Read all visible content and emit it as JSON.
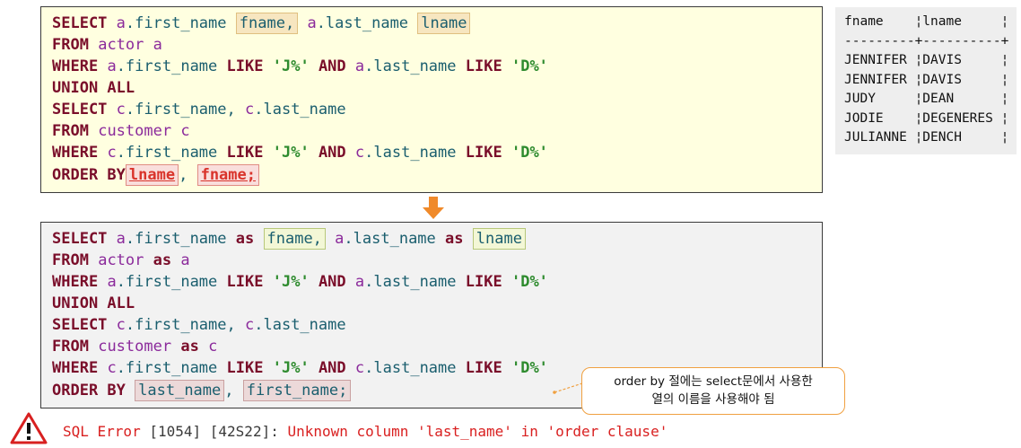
{
  "query1": {
    "l1": {
      "select": "SELECT",
      "a1": "a",
      "f1": ".first_name",
      "alias1": "fname,",
      "a2": "a",
      "f2": ".last_name",
      "alias2": "lname"
    },
    "l2": {
      "from": "FROM",
      "tbl": "actor a"
    },
    "l3": {
      "where": "WHERE",
      "a1": "a",
      "f1": ".first_name",
      "like1": "LIKE",
      "s1": "'J%'",
      "and": "AND",
      "a2": "a",
      "f2": ".last_name",
      "like2": "LIKE",
      "s2": "'D%'"
    },
    "l4": {
      "union": "UNION ALL"
    },
    "l5": {
      "select": "SELECT",
      "c1": "c",
      "f1": ".first_name,",
      "c2": "c",
      "f2": ".last_name"
    },
    "l6": {
      "from": "FROM",
      "tbl": "customer c"
    },
    "l7": {
      "where": "WHERE",
      "c1": "c",
      "f1": ".first_name",
      "like1": "LIKE",
      "s1": "'J%'",
      "and": "AND",
      "c2": "c",
      "f2": ".last_name",
      "like2": "LIKE",
      "s2": "'D%'"
    },
    "l8": {
      "order": "ORDER BY",
      "o1": "lname",
      "comma": ",",
      "o2": "fname;"
    }
  },
  "query2": {
    "l1": {
      "select": "SELECT",
      "a1": "a",
      "f1": ".first_name",
      "as1": "as",
      "alias1": "fname,",
      "a2": "a",
      "f2": ".last_name",
      "as2": "as",
      "alias2": "lname"
    },
    "l2": {
      "from": "FROM",
      "tbl": "actor",
      "as": "as",
      "a": "a"
    },
    "l3": {
      "where": "WHERE",
      "a1": "a",
      "f1": ".first_name",
      "like1": "LIKE",
      "s1": "'J%'",
      "and": "AND",
      "a2": "a",
      "f2": ".last_name",
      "like2": "LIKE",
      "s2": "'D%'"
    },
    "l4": {
      "union": "UNION ALL"
    },
    "l5": {
      "select": "SELECT",
      "c1": "c",
      "f1": ".first_name,",
      "c2": "c",
      "f2": ".last_name"
    },
    "l6": {
      "from": "FROM",
      "tbl": "customer",
      "as": "as",
      "c": "c"
    },
    "l7": {
      "where": "WHERE",
      "c1": "c",
      "f1": ".first_name",
      "like1": "LIKE",
      "s1": "'J%'",
      "and": "AND",
      "c2": "c",
      "f2": ".last_name",
      "like2": "LIKE",
      "s2": "'D%'"
    },
    "l8": {
      "order": "ORDER BY",
      "o1": "last_name",
      "comma": ",",
      "o2": "first_name;"
    }
  },
  "result_table": {
    "text": "fname    ¦lname     ¦\n---------+----------+\nJENNIFER ¦DAVIS     ¦\nJENNIFER ¦DAVIS     ¦\nJUDY     ¦DEAN      ¦\nJODIE    ¦DEGENERES ¦\nJULIANNE ¦DENCH     ¦"
  },
  "callout": {
    "line1": "order by 절에는 select문에서 사용한",
    "line2": "열의 이름을 사용해야 됨"
  },
  "error": {
    "prefix": "SQL Error",
    "code": "[1054] [42S22]:",
    "message": "Unknown column 'last_name' in 'order clause'"
  },
  "icons": {
    "arrow": "down-arrow-icon",
    "warning": "warning-icon"
  },
  "colors": {
    "keyword": "#7a0e2a",
    "identifier": "#1a5e6e",
    "table": "#8b2a9b",
    "string": "#2e8b2e",
    "error": "#d92020",
    "arrow": "#f08a2a"
  }
}
